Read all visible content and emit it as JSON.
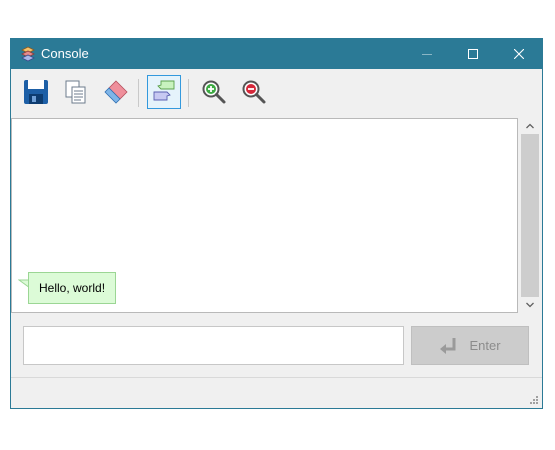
{
  "window": {
    "title": "Console",
    "app_icon": "stack-layers-icon",
    "controls": [
      "minimize-icon",
      "maximize-icon",
      "close-icon"
    ],
    "accent_color": "#2b7a96"
  },
  "toolbar": {
    "buttons": [
      {
        "name": "save",
        "icon": "floppy-disk-icon"
      },
      {
        "name": "copy",
        "icon": "copy-documents-icon"
      },
      {
        "name": "clear",
        "icon": "eraser-icon"
      },
      {
        "name": "toggle-bubbles",
        "icon": "speech-bubbles-icon",
        "active": true
      },
      {
        "name": "zoom-in",
        "icon": "zoom-in-icon"
      },
      {
        "name": "zoom-out",
        "icon": "zoom-out-icon"
      }
    ]
  },
  "console": {
    "messages": [
      {
        "text": "Hello, world!",
        "bubble_color": "#dcfbd7"
      }
    ]
  },
  "input": {
    "value": "",
    "placeholder": ""
  },
  "enter_button": {
    "label": "Enter",
    "icon": "return-arrow-icon",
    "enabled": false
  }
}
